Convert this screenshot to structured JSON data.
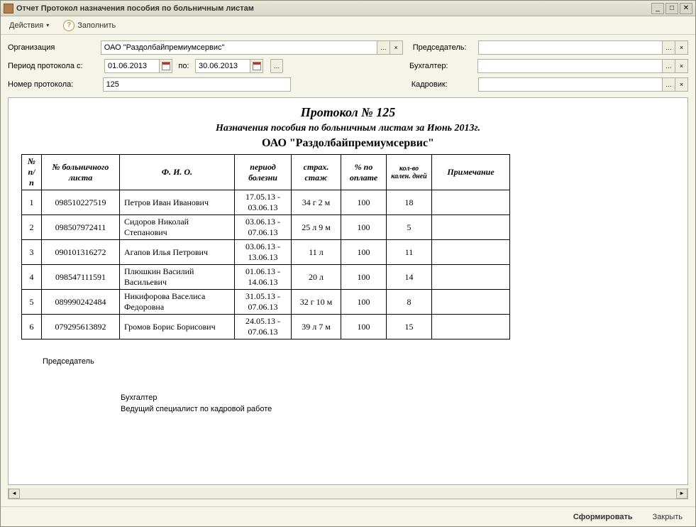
{
  "window": {
    "title": "Отчет  Протокол назначения пособия по больничным листам"
  },
  "toolbar": {
    "actions_label": "Действия",
    "fill_label": "Заполнить"
  },
  "filters": {
    "org_label": "Организация",
    "org_value": "ОАО \"Раздолбайпремиумсервис\"",
    "period_from_label": "Период протокола с:",
    "period_from_value": "01.06.2013",
    "period_to_label": "по:",
    "period_to_value": "30.06.2013",
    "protocol_num_label": "Номер протокола:",
    "protocol_num_value": "125",
    "chairman_label": "Председатель:",
    "chairman_value": "",
    "accountant_label": "Бухгалтер:",
    "accountant_value": "",
    "hr_label": "Кадровик:",
    "hr_value": ""
  },
  "report": {
    "title": "Протокол № 125",
    "subtitle": "Назначения пособия по больничным листам за Июнь 2013г.",
    "orgname": "ОАО \"Раздолбайпремиумсервис\"",
    "headers": {
      "n": "№ п/п",
      "sheet_num": "№ больничного листа",
      "fio": "Ф. И. О.",
      "period": "период болезни",
      "stazh": "страх. стаж",
      "pct": "% по оплате",
      "days": "кол-во кален. дней",
      "note": "Примечание"
    },
    "rows": [
      {
        "n": "1",
        "num": "098510227519",
        "fio": "Петров Иван Иванович",
        "period": "17.05.13 - 03.06.13",
        "stazh": "34 г 2 м",
        "pct": "100",
        "days": "18",
        "note": ""
      },
      {
        "n": "2",
        "num": "098507972411",
        "fio": "Сидоров Николай Степанович",
        "period": "03.06.13 - 07.06.13",
        "stazh": "25 л 9 м",
        "pct": "100",
        "days": "5",
        "note": ""
      },
      {
        "n": "3",
        "num": "090101316272",
        "fio": "Агапов Илья Петрович",
        "period": "03.06.13 - 13.06.13",
        "stazh": "11 л",
        "pct": "100",
        "days": "11",
        "note": ""
      },
      {
        "n": "4",
        "num": "098547111591",
        "fio": "Плюшкин Василий Васильевич",
        "period": "01.06.13 - 14.06.13",
        "stazh": "20 л",
        "pct": "100",
        "days": "14",
        "note": ""
      },
      {
        "n": "5",
        "num": "089990242484",
        "fio": "Никифорова Васелиса Федоровна",
        "period": "31.05.13 - 07.06.13",
        "stazh": "32 г 10 м",
        "pct": "100",
        "days": "8",
        "note": ""
      },
      {
        "n": "6",
        "num": "079295613892",
        "fio": "Громов Борис Борисович",
        "period": "24.05.13 - 07.06.13",
        "stazh": "39 л 7 м",
        "pct": "100",
        "days": "15",
        "note": ""
      }
    ],
    "sig_chairman": "Председатель",
    "sig_accountant": "Бухгалтер",
    "sig_hr": "Ведущий  специалист по кадровой работе"
  },
  "bottom": {
    "generate_label": "Сформировать",
    "close_label": "Закрыть"
  }
}
